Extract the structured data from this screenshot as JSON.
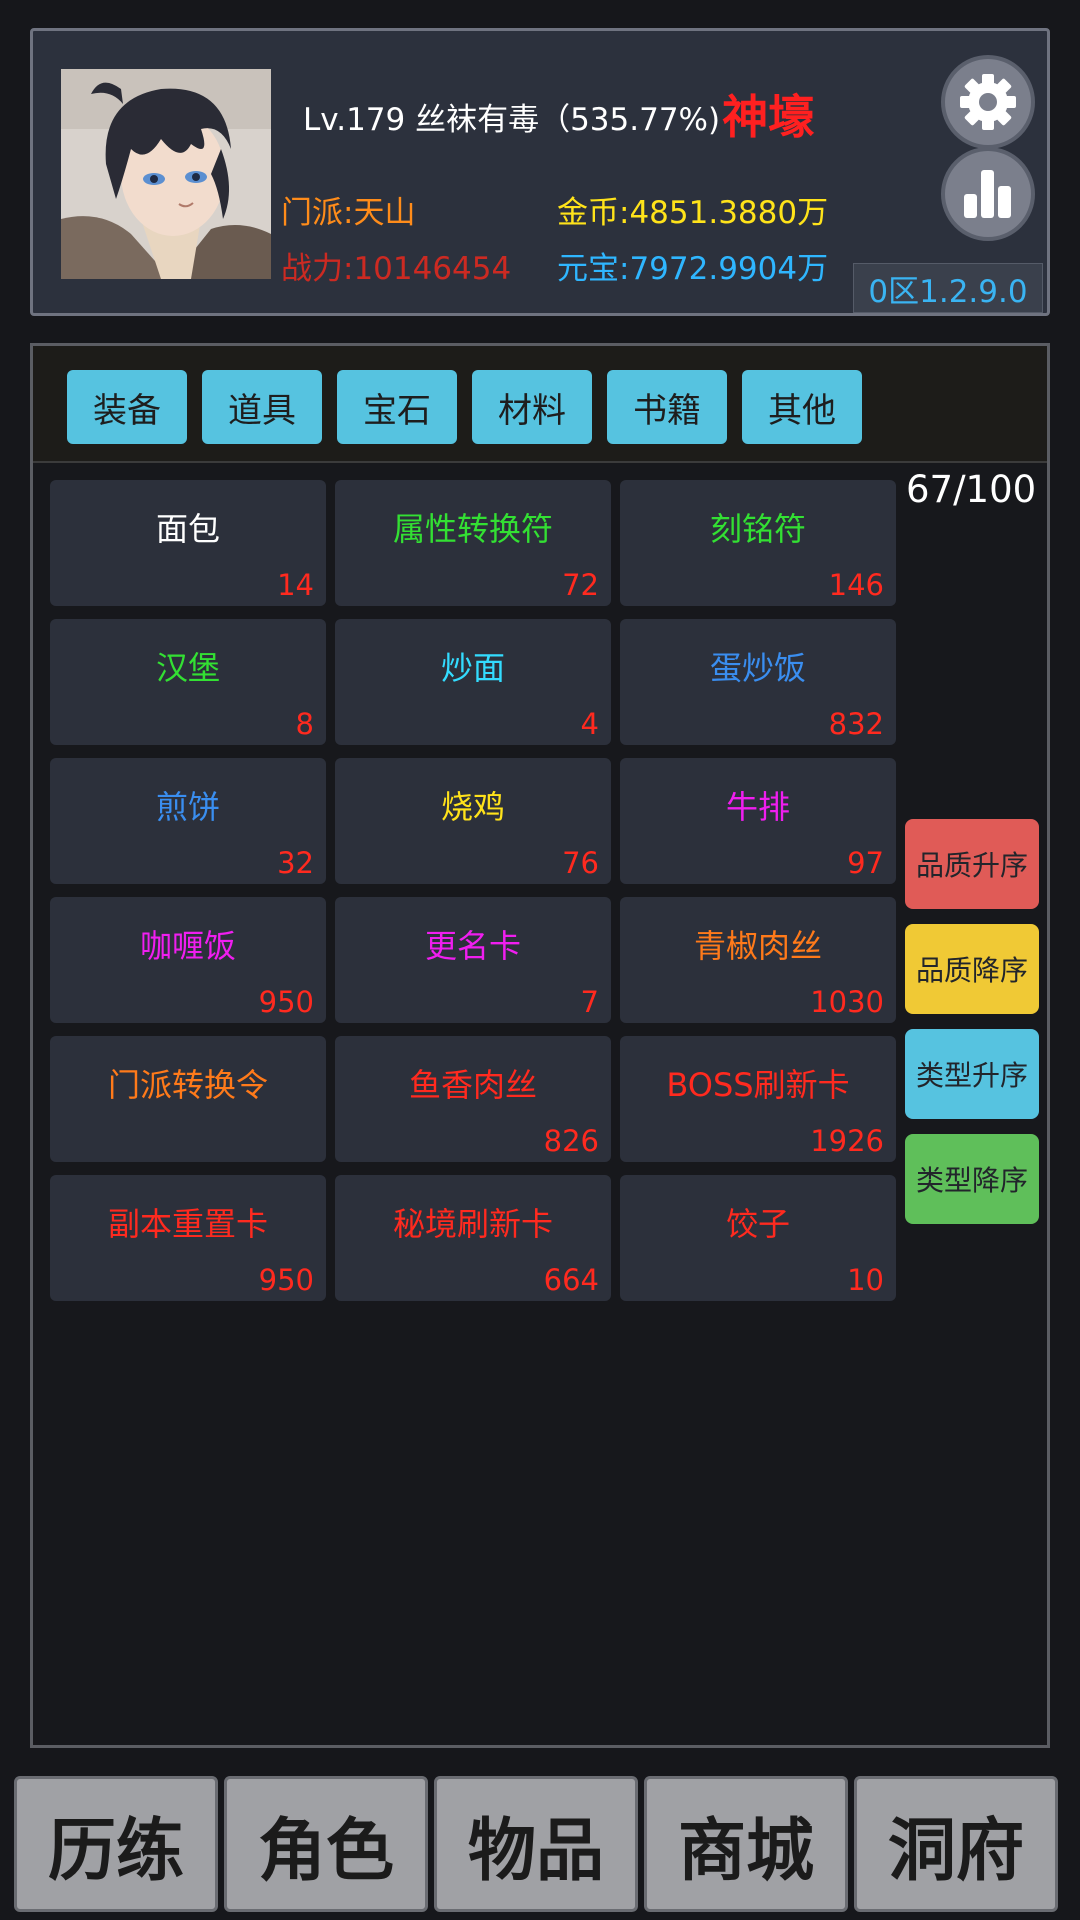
{
  "player": {
    "level_name": "Lv.179  丝袜有毒（535.77%)",
    "tier": "神壕",
    "sect": "门派:天山",
    "power": "战力:10146454",
    "gold": "金币:4851.3880万",
    "ingot": "元宝:7972.9904万",
    "version": "0区1.2.9.0"
  },
  "icons": {
    "settings": "gear-icon",
    "stats": "bar-chart-icon"
  },
  "tabs": [
    "装备",
    "道具",
    "宝石",
    "材料",
    "书籍",
    "其他"
  ],
  "capacity": "67/100",
  "items": [
    {
      "name": "面包",
      "qty": "14",
      "color": "#ffffff"
    },
    {
      "name": "属性转换符",
      "qty": "72",
      "color": "#33e033"
    },
    {
      "name": "刻铭符",
      "qty": "146",
      "color": "#33e033"
    },
    {
      "name": "汉堡",
      "qty": "8",
      "color": "#33e033"
    },
    {
      "name": "炒面",
      "qty": "4",
      "color": "#33dcff"
    },
    {
      "name": "蛋炒饭",
      "qty": "832",
      "color": "#3a8ef0"
    },
    {
      "name": "煎饼",
      "qty": "32",
      "color": "#3a8ef0"
    },
    {
      "name": "烧鸡",
      "qty": "76",
      "color": "#ffe21a"
    },
    {
      "name": "牛排",
      "qty": "97",
      "color": "#f01ef0"
    },
    {
      "name": "咖喱饭",
      "qty": "950",
      "color": "#f01ef0"
    },
    {
      "name": "更名卡",
      "qty": "7",
      "color": "#f01ef0"
    },
    {
      "name": "青椒肉丝",
      "qty": "1030",
      "color": "#ff7a1a"
    },
    {
      "name": "门派转换令",
      "qty": "",
      "color": "#ff7a1a"
    },
    {
      "name": "鱼香肉丝",
      "qty": "826",
      "color": "#ff2a1f"
    },
    {
      "name": "BOSS刷新卡",
      "qty": "1926",
      "color": "#ff2a1f"
    },
    {
      "name": "副本重置卡",
      "qty": "950",
      "color": "#ff2a1f"
    },
    {
      "name": "秘境刷新卡",
      "qty": "664",
      "color": "#ff2a1f"
    },
    {
      "name": "饺子",
      "qty": "10",
      "color": "#ff2a1f"
    }
  ],
  "sort_buttons": [
    {
      "label": "品质升序",
      "color": "#e05b57"
    },
    {
      "label": "品质降序",
      "color": "#f0c935"
    },
    {
      "label": "类型升序",
      "color": "#56c3e0"
    },
    {
      "label": "类型降序",
      "color": "#5fbf5a"
    }
  ],
  "bottom_nav": [
    "历练",
    "角色",
    "物品",
    "商城",
    "洞府"
  ]
}
